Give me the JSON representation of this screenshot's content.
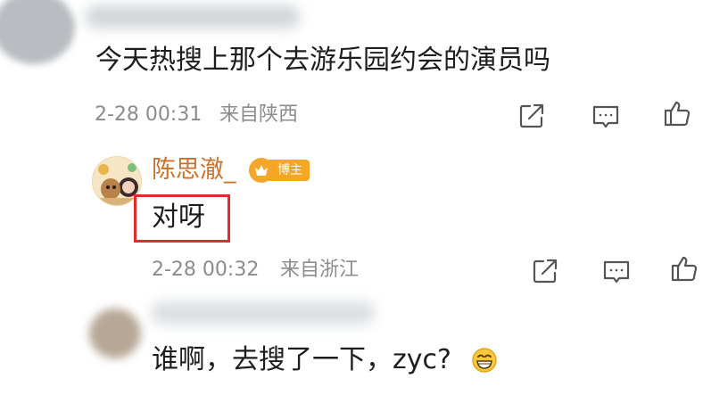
{
  "comment": {
    "text": "今天热搜上那个去游乐园约会的演员吗",
    "time": "2-28 00:31",
    "location": "来自陕西",
    "actions": [
      "share-icon",
      "comment-icon",
      "like-icon"
    ]
  },
  "reply": {
    "username": "陈思澈_",
    "badge": "博主",
    "text": "对呀",
    "time": "2-28 00:32",
    "location": "来自浙江",
    "highlight_color": "#e12a2a",
    "actions": [
      "share-icon",
      "comment-icon",
      "like-icon"
    ]
  },
  "next_comment": {
    "text": "谁啊，去搜了一下，zyc?",
    "emoji": "grinning-face-icon"
  },
  "colors": {
    "username": "#c8722d",
    "badge": "#f5a623",
    "meta": "#8c8c8c"
  }
}
